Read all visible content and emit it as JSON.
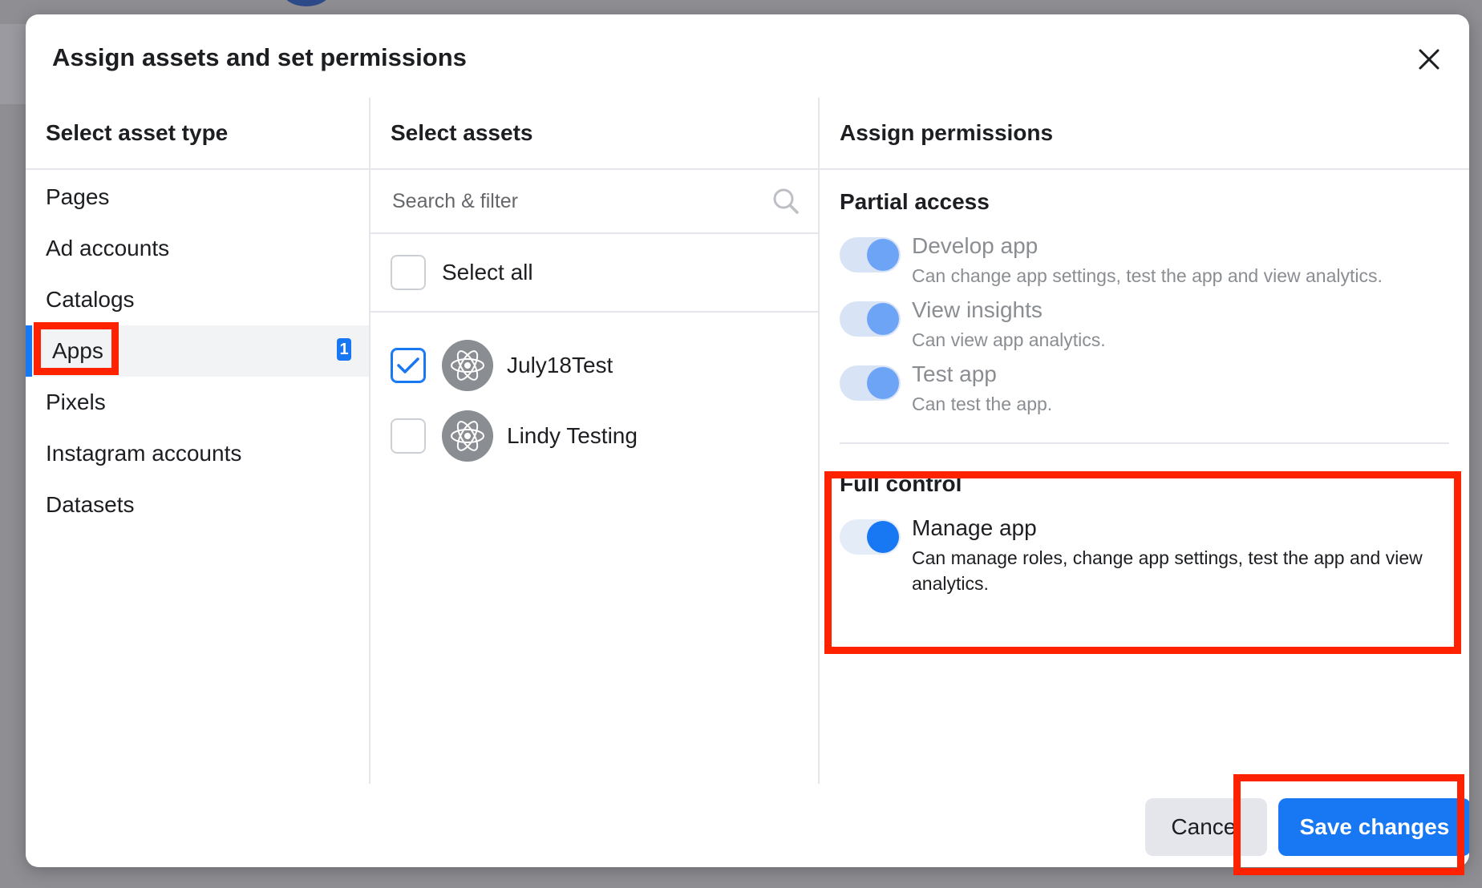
{
  "dialog": {
    "title": "Assign assets and set permissions"
  },
  "asset_types": {
    "heading": "Select asset type",
    "items": [
      {
        "label": "Pages"
      },
      {
        "label": "Ad accounts"
      },
      {
        "label": "Catalogs"
      },
      {
        "label": "Apps",
        "badge": "1",
        "selected": true
      },
      {
        "label": "Pixels"
      },
      {
        "label": "Instagram accounts"
      },
      {
        "label": "Datasets"
      }
    ]
  },
  "assets": {
    "heading": "Select assets",
    "search_placeholder": "Search & filter",
    "select_all_label": "Select all",
    "items": [
      {
        "name": "July18Test",
        "checked": true
      },
      {
        "name": "Lindy Testing",
        "checked": false
      }
    ]
  },
  "permissions": {
    "heading": "Assign permissions",
    "partial": {
      "title": "Partial access",
      "items": [
        {
          "name": "Develop app",
          "desc": "Can change app settings, test the app and view analytics."
        },
        {
          "name": "View insights",
          "desc": "Can view app analytics."
        },
        {
          "name": "Test app",
          "desc": "Can test the app."
        }
      ]
    },
    "full": {
      "title": "Full control",
      "items": [
        {
          "name": "Manage app",
          "desc": "Can manage roles, change app settings, test the app and view analytics."
        }
      ]
    }
  },
  "footer": {
    "cancel_label": "Cancel",
    "save_label": "Save changes"
  },
  "colors": {
    "accent": "#1877f2",
    "highlight": "#ff2200"
  }
}
